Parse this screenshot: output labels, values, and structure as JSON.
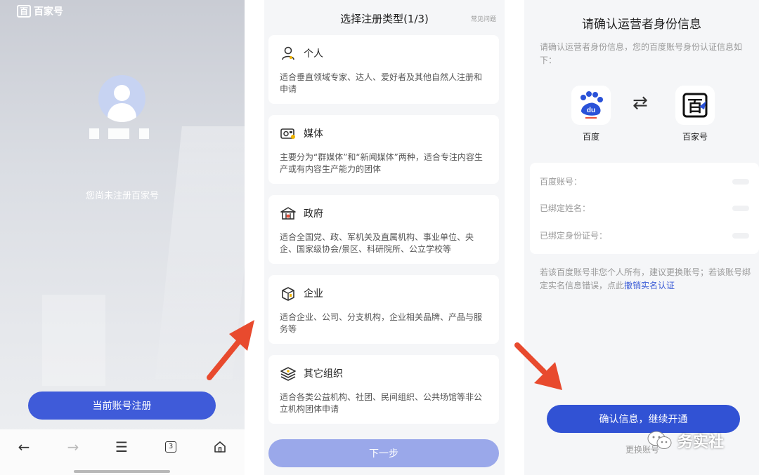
{
  "panel1": {
    "logo_box": "百",
    "logo_text": "百家号",
    "status": "您尚未注册百家号",
    "register_button": "当前账号注册",
    "nav": {
      "back_icon": "←",
      "forward_icon": "→",
      "menu_icon": "☰",
      "tab_count": "3"
    }
  },
  "panel2": {
    "title": "选择注册类型(1/3)",
    "faq": "常见问题",
    "types": [
      {
        "icon": "person-icon",
        "title": "个人",
        "desc": "适合垂直领域专家、达人、爱好者及其他自然人注册和申请"
      },
      {
        "icon": "media-icon",
        "title": "媒体",
        "desc": "主要分为“群媒体”和“新闻媒体”两种，适合专注内容生产或有内容生产能力的团体"
      },
      {
        "icon": "government-icon",
        "title": "政府",
        "desc": "适合全国党、政、军机关及直属机构、事业单位、央企、国家级协会/景区、科研院所、公立学校等"
      },
      {
        "icon": "enterprise-icon",
        "title": "企业",
        "desc": "适合企业、公司、分支机构，企业相关品牌、产品与服务等"
      },
      {
        "icon": "organization-icon",
        "title": "其它组织",
        "desc": "适合各类公益机构、社团、民间组织、公共场馆等非公立机构团体申请"
      }
    ],
    "next_button": "下一步"
  },
  "panel3": {
    "title": "请确认运营者身份信息",
    "intro": "请确认运营者身份信息，您的百度账号身份认证信息如下：",
    "app_left": "百度",
    "app_left_logo": "du",
    "app_right": "百家号",
    "app_right_logo": "百",
    "swap_icon": "⇄",
    "rows": [
      "百度账号：",
      "已绑定姓名：",
      "已绑定身份证号："
    ],
    "note": "若该百度账号非您个人所有，建议更换账号；若该账号绑定实名信息错误，点此",
    "note_link": "撤销实名认证",
    "confirm_button": "确认信息，继续开通",
    "change_link": "更换账号"
  },
  "watermark": {
    "text": "务实社"
  },
  "colors": {
    "primary": "#3f5bd9",
    "disabled": "#9aa8ea",
    "arrow": "#e84a2e",
    "link": "#3a5bd6"
  }
}
